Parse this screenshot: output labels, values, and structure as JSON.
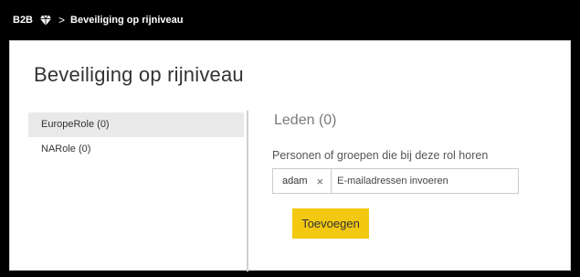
{
  "topbar": {
    "brand": "B2B",
    "icon": "diamond-gem-icon",
    "separator": ">",
    "breadcrumb_current": "Beveiliging op rijniveau"
  },
  "page": {
    "title": "Beveiliging op rijniveau"
  },
  "roles": {
    "items": [
      {
        "label": "EuropeRole (0)",
        "selected": true
      },
      {
        "label": "NARole (0)",
        "selected": false
      }
    ]
  },
  "members": {
    "title": "Leden (0)",
    "field_label": "Personen of groepen die bij deze rol horen",
    "chips": [
      {
        "label": "adam",
        "remove_glyph": "×"
      }
    ],
    "input_placeholder": "E-mailadressen invoeren",
    "input_value": ""
  },
  "actions": {
    "add_label": "Toevoegen"
  },
  "colors": {
    "accent": "#f2c811",
    "topbar_bg": "#000000",
    "selected_role_bg": "#e9e9e9"
  }
}
